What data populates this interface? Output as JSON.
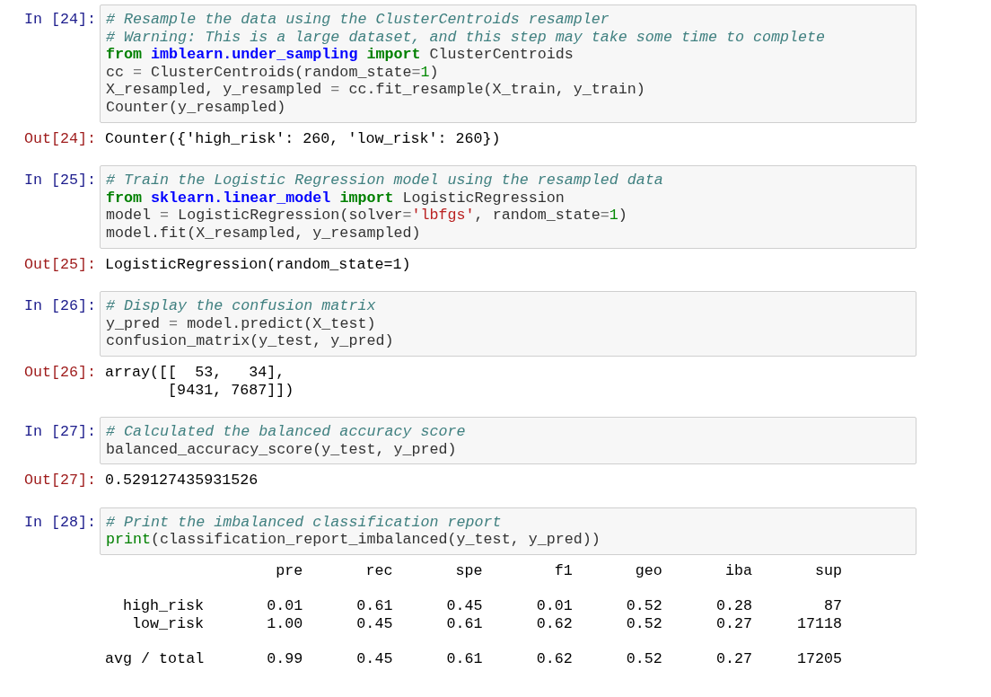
{
  "cells": [
    {
      "prompt": "In [24]:",
      "code": [
        [
          {
            "kind": "comment",
            "text": "# Resample the data using the ClusterCentroids resampler"
          }
        ],
        [
          {
            "kind": "comment",
            "text": "# Warning: This is a large dataset, and this step may take some time to complete"
          }
        ],
        [
          {
            "kind": "keyword",
            "text": "from "
          },
          {
            "kind": "namespace",
            "text": "imblearn.under_sampling "
          },
          {
            "kind": "keyword",
            "text": "import"
          },
          {
            "kind": "plain",
            "text": " ClusterCentroids"
          }
        ],
        [
          {
            "kind": "plain",
            "text": "cc "
          },
          {
            "kind": "operator",
            "text": "="
          },
          {
            "kind": "plain",
            "text": " ClusterCentroids(random_state"
          },
          {
            "kind": "operator",
            "text": "="
          },
          {
            "kind": "number",
            "text": "1"
          },
          {
            "kind": "plain",
            "text": ")"
          }
        ],
        [
          {
            "kind": "plain",
            "text": "X_resampled, y_resampled "
          },
          {
            "kind": "operator",
            "text": "="
          },
          {
            "kind": "plain",
            "text": " cc.fit_resample(X_train, y_train)"
          }
        ],
        [
          {
            "kind": "plain",
            "text": "Counter(y_resampled)"
          }
        ]
      ],
      "output": {
        "kind": "text",
        "prompt": "Out[24]:",
        "lines": [
          "Counter({'high_risk': 260, 'low_risk': 260})"
        ]
      }
    },
    {
      "prompt": "In [25]:",
      "code": [
        [
          {
            "kind": "comment",
            "text": "# Train the Logistic Regression model using the resampled data"
          }
        ],
        [
          {
            "kind": "keyword",
            "text": "from "
          },
          {
            "kind": "namespace",
            "text": "sklearn.linear_model "
          },
          {
            "kind": "keyword",
            "text": "import"
          },
          {
            "kind": "plain",
            "text": " LogisticRegression"
          }
        ],
        [
          {
            "kind": "plain",
            "text": "model "
          },
          {
            "kind": "operator",
            "text": "="
          },
          {
            "kind": "plain",
            "text": " LogisticRegression(solver"
          },
          {
            "kind": "operator",
            "text": "="
          },
          {
            "kind": "string",
            "text": "'lbfgs'"
          },
          {
            "kind": "plain",
            "text": ", random_state"
          },
          {
            "kind": "operator",
            "text": "="
          },
          {
            "kind": "number",
            "text": "1"
          },
          {
            "kind": "plain",
            "text": ")"
          }
        ],
        [
          {
            "kind": "plain",
            "text": "model.fit(X_resampled, y_resampled)"
          }
        ]
      ],
      "output": {
        "kind": "text",
        "prompt": "Out[25]:",
        "lines": [
          "LogisticRegression(random_state=1)"
        ]
      }
    },
    {
      "prompt": "In [26]:",
      "code": [
        [
          {
            "kind": "comment",
            "text": "# Display the confusion matrix"
          }
        ],
        [
          {
            "kind": "plain",
            "text": "y_pred "
          },
          {
            "kind": "operator",
            "text": "="
          },
          {
            "kind": "plain",
            "text": " model.predict(X_test)"
          }
        ],
        [
          {
            "kind": "plain",
            "text": "confusion_matrix(y_test, y_pred)"
          }
        ]
      ],
      "output": {
        "kind": "text",
        "prompt": "Out[26]:",
        "lines": [
          "array([[  53,   34],",
          "       [9431, 7687]])"
        ]
      }
    },
    {
      "prompt": "In [27]:",
      "code": [
        [
          {
            "kind": "comment",
            "text": "# Calculated the balanced accuracy score"
          }
        ],
        [
          {
            "kind": "plain",
            "text": "balanced_accuracy_score(y_test, y_pred)"
          }
        ]
      ],
      "output": {
        "kind": "text",
        "prompt": "Out[27]:",
        "lines": [
          "0.529127435931526"
        ]
      }
    },
    {
      "prompt": "In [28]:",
      "code": [
        [
          {
            "kind": "comment",
            "text": "# Print the imbalanced classification report"
          }
        ],
        [
          {
            "kind": "builtin",
            "text": "print"
          },
          {
            "kind": "plain",
            "text": "(classification_report_imbalanced(y_test, y_pred))"
          }
        ]
      ],
      "output": {
        "kind": "report",
        "columns": [
          "pre",
          "rec",
          "spe",
          "f1",
          "geo",
          "iba",
          "sup"
        ],
        "row_groups": [
          [
            {
              "label": "high_risk",
              "values": [
                "0.01",
                "0.61",
                "0.45",
                "0.01",
                "0.52",
                "0.28",
                "87"
              ]
            },
            {
              "label": "low_risk",
              "values": [
                "1.00",
                "0.45",
                "0.61",
                "0.62",
                "0.52",
                "0.27",
                "17118"
              ]
            }
          ],
          [
            {
              "label": "avg / total",
              "values": [
                "0.99",
                "0.45",
                "0.61",
                "0.62",
                "0.52",
                "0.27",
                "17205"
              ]
            }
          ]
        ]
      }
    }
  ]
}
